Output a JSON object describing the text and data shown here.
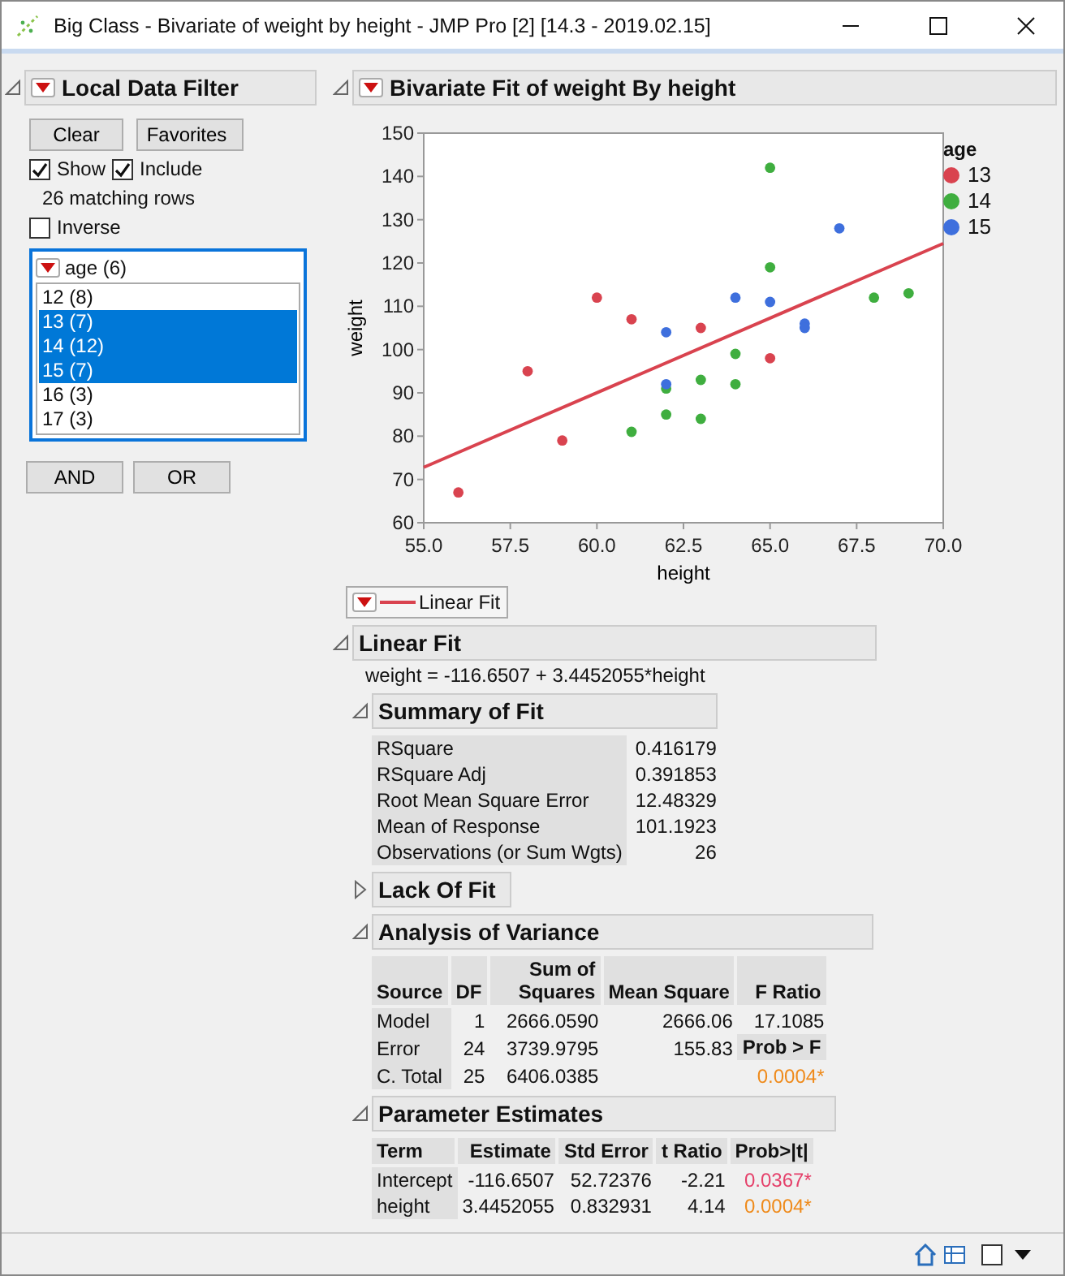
{
  "window": {
    "title": "Big Class - Bivariate of weight by height - JMP Pro [2] [14.3  - 2019.02.15]"
  },
  "filter": {
    "title": "Local Data Filter",
    "expanded": true,
    "clear": "Clear",
    "favorites": "Favorites",
    "show": {
      "label": "Show",
      "checked": true
    },
    "include": {
      "label": "Include",
      "checked": true
    },
    "matching": "26 matching rows",
    "inverse": {
      "label": "Inverse",
      "checked": false
    },
    "column": {
      "title": "age (6)",
      "items": [
        {
          "label": "12 (8)",
          "selected": false
        },
        {
          "label": "13 (7)",
          "selected": true
        },
        {
          "label": "14 (12)",
          "selected": true
        },
        {
          "label": "15 (7)",
          "selected": true
        },
        {
          "label": "16 (3)",
          "selected": false
        },
        {
          "label": "17 (3)",
          "selected": false
        }
      ]
    },
    "logic": [
      "AND",
      "OR"
    ]
  },
  "report": {
    "title": "Bivariate Fit of weight By height",
    "expanded": true,
    "chart_data": {
      "type": "scatter",
      "xlabel": "height",
      "ylabel": "weight",
      "xlim": [
        55,
        70
      ],
      "ylim": [
        60,
        150
      ],
      "xticks": [
        {
          "value": 55,
          "label": "55.0"
        },
        {
          "value": 57.5,
          "label": "57.5"
        },
        {
          "value": 60,
          "label": "60.0"
        },
        {
          "value": 62.5,
          "label": "62.5"
        },
        {
          "value": 65,
          "label": "65.0"
        },
        {
          "value": 67.5,
          "label": "67.5"
        },
        {
          "value": 70,
          "label": "70.0"
        }
      ],
      "yticks": [
        60,
        70,
        80,
        90,
        100,
        110,
        120,
        130,
        140,
        150
      ],
      "series": [
        {
          "name": "13",
          "color": "#d9434f",
          "x": [
            56,
            58,
            59,
            60,
            61,
            63,
            65
          ],
          "values": [
            67,
            95,
            79,
            112,
            107,
            105,
            98
          ]
        },
        {
          "name": "14",
          "color": "#3fae3f",
          "x": [
            65,
            65,
            68,
            69,
            64,
            63,
            64,
            62,
            62,
            63,
            61
          ],
          "values": [
            142,
            119,
            112,
            113,
            99,
            93,
            92,
            91,
            85,
            84,
            81
          ]
        },
        {
          "name": "15",
          "color": "#3e6fdd",
          "x": [
            67,
            64,
            65,
            66,
            66,
            62,
            62
          ],
          "values": [
            128,
            112,
            111,
            106,
            105,
            104,
            92
          ]
        },
        {
          "name": "Linear Fit",
          "type": "line",
          "color": "#d9434f",
          "x": [
            55,
            70
          ],
          "values": [
            72.8,
            124.5
          ]
        }
      ],
      "legend": {
        "title": "age"
      }
    },
    "linear_fit": {
      "title": "Linear Fit",
      "expanded": true,
      "equation": "weight = -116.6507 + 3.4452055*height",
      "summary": {
        "title": "Summary of Fit",
        "expanded": true,
        "rows": [
          {
            "label": "RSquare",
            "value": "0.416179"
          },
          {
            "label": "RSquare Adj",
            "value": "0.391853"
          },
          {
            "label": "Root Mean Square Error",
            "value": "12.48329"
          },
          {
            "label": "Mean of Response",
            "value": "101.1923"
          },
          {
            "label": "Observations (or Sum Wgts)",
            "value": "26"
          }
        ]
      },
      "lack_of_fit": {
        "title": "Lack Of Fit",
        "expanded": false
      },
      "anova": {
        "title": "Analysis of Variance",
        "expanded": true,
        "columns": [
          "Source",
          "DF",
          "Sum of Squares",
          "Mean Square",
          "F Ratio"
        ],
        "rows": [
          {
            "source": "Model",
            "df": "1",
            "ss": "2666.0590",
            "ms": "2666.06",
            "last": {
              "kind": "value",
              "text": "17.1085"
            }
          },
          {
            "source": "Error",
            "df": "24",
            "ss": "3739.9795",
            "ms": "155.83",
            "last": {
              "kind": "heading",
              "text": "Prob > F"
            }
          },
          {
            "source": "C. Total",
            "df": "25",
            "ss": "6406.0385",
            "last": {
              "kind": "prob",
              "text": "0.0004*",
              "color": "#ef8a1a"
            }
          }
        ]
      },
      "parameters": {
        "title": "Parameter Estimates",
        "expanded": true,
        "columns": [
          "Term",
          "Estimate",
          "Std Error",
          "t Ratio",
          "Prob>|t|"
        ],
        "rows": [
          {
            "term": "Intercept",
            "estimate": "-116.6507",
            "std_error": "52.72376",
            "t_ratio": "-2.21",
            "prob": "0.0367*",
            "color": "#e5406a"
          },
          {
            "term": "height",
            "estimate": "3.4452055",
            "std_error": "0.832931",
            "t_ratio": "4.14",
            "prob": "0.0004*",
            "color": "#ef8a1a"
          }
        ]
      }
    }
  }
}
